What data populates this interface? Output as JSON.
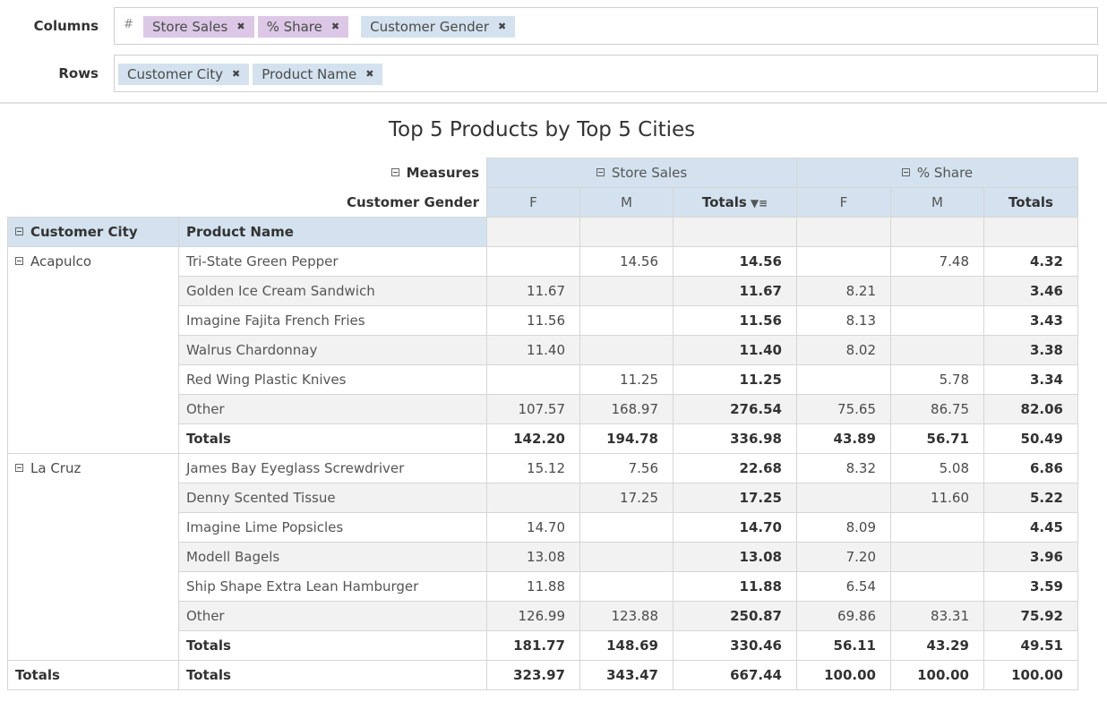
{
  "shelves": {
    "columns_label": "Columns",
    "rows_label": "Rows",
    "measures_marker": "#",
    "column_chips": [
      "Store Sales",
      "% Share"
    ],
    "column_dim_chips": [
      "Customer Gender"
    ],
    "row_chips": [
      "Customer City",
      "Product Name"
    ],
    "remove_glyph": "✖"
  },
  "title": "Top 5 Products by Top 5 Cities",
  "pivot": {
    "measures_label": "Measures",
    "gender_label": "Customer Gender",
    "measure_groups": [
      "Store Sales",
      "% Share"
    ],
    "sub_headers": [
      "F",
      "M",
      "Totals",
      "F",
      "M",
      "Totals"
    ],
    "row_axis_headers": [
      "Customer City",
      "Product Name"
    ],
    "totals_label": "Totals",
    "cities": [
      {
        "name": "Acapulco",
        "rows": [
          {
            "product": "Tri-State Green Pepper",
            "values": [
              "",
              "14.56",
              "14.56",
              "",
              "7.48",
              "4.32"
            ]
          },
          {
            "product": "Golden Ice Cream Sandwich",
            "values": [
              "11.67",
              "",
              "11.67",
              "8.21",
              "",
              "3.46"
            ]
          },
          {
            "product": "Imagine Fajita French Fries",
            "values": [
              "11.56",
              "",
              "11.56",
              "8.13",
              "",
              "3.43"
            ]
          },
          {
            "product": "Walrus Chardonnay",
            "values": [
              "11.40",
              "",
              "11.40",
              "8.02",
              "",
              "3.38"
            ]
          },
          {
            "product": "Red Wing Plastic Knives",
            "values": [
              "",
              "11.25",
              "11.25",
              "",
              "5.78",
              "3.34"
            ]
          },
          {
            "product": "Other",
            "values": [
              "107.57",
              "168.97",
              "276.54",
              "75.65",
              "86.75",
              "82.06"
            ]
          }
        ],
        "totals": [
          "142.20",
          "194.78",
          "336.98",
          "43.89",
          "56.71",
          "50.49"
        ]
      },
      {
        "name": "La Cruz",
        "rows": [
          {
            "product": "James Bay Eyeglass Screwdriver",
            "values": [
              "15.12",
              "7.56",
              "22.68",
              "8.32",
              "5.08",
              "6.86"
            ]
          },
          {
            "product": "Denny Scented Tissue",
            "values": [
              "",
              "17.25",
              "17.25",
              "",
              "11.60",
              "5.22"
            ]
          },
          {
            "product": "Imagine Lime Popsicles",
            "values": [
              "14.70",
              "",
              "14.70",
              "8.09",
              "",
              "4.45"
            ]
          },
          {
            "product": "Modell Bagels",
            "values": [
              "13.08",
              "",
              "13.08",
              "7.20",
              "",
              "3.96"
            ]
          },
          {
            "product": "Ship Shape Extra Lean Hamburger",
            "values": [
              "11.88",
              "",
              "11.88",
              "6.54",
              "",
              "3.59"
            ]
          },
          {
            "product": "Other",
            "values": [
              "126.99",
              "123.88",
              "250.87",
              "69.86",
              "83.31",
              "75.92"
            ]
          }
        ],
        "totals": [
          "181.77",
          "148.69",
          "330.46",
          "56.11",
          "43.29",
          "49.51"
        ]
      }
    ],
    "grand_totals": [
      "323.97",
      "343.47",
      "667.44",
      "100.00",
      "100.00",
      "100.00"
    ]
  }
}
